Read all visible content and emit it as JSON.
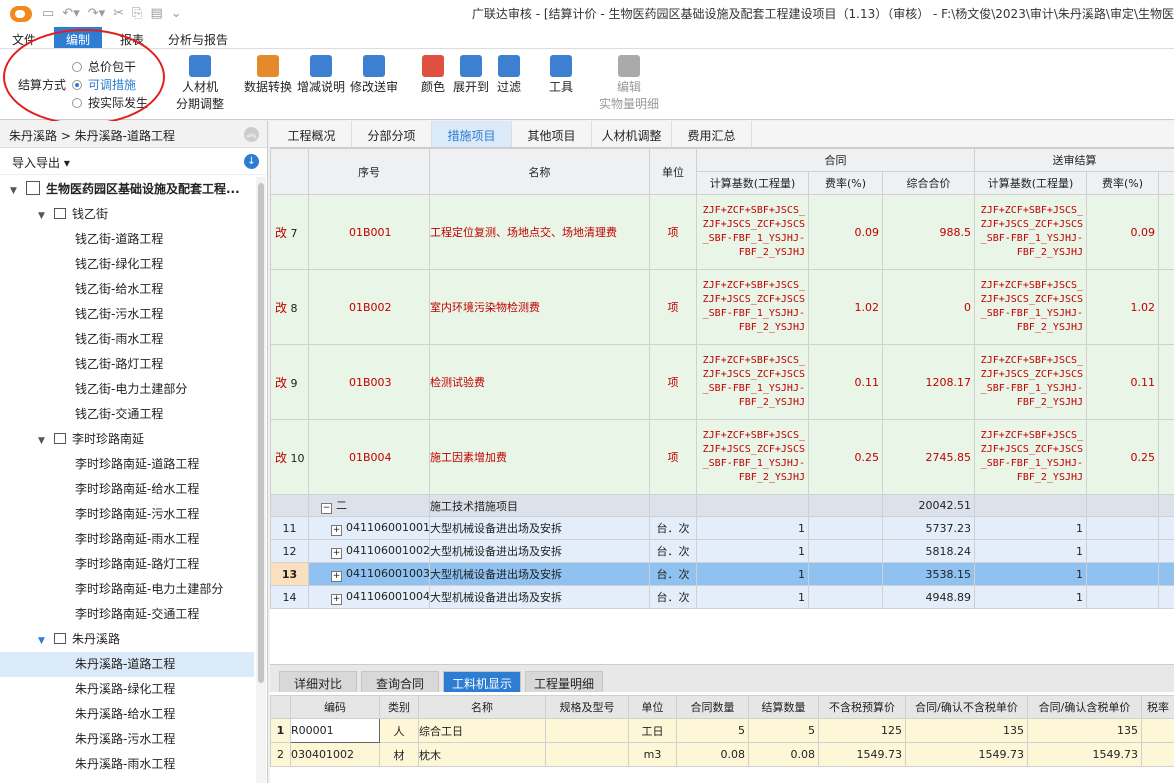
{
  "titlebar": {
    "title": "广联达审核 - [结算计价 - 生物医药园区基础设施及配套工程建设项目（1.13）（审核） - F:\\杨文俊\\2023\\审计\\朱丹溪路\\审定\\生物医"
  },
  "menus": [
    "文件",
    "编制",
    "报表",
    "分析与报告"
  ],
  "ribbon": {
    "settle_label": "结算方式",
    "opt1": "总价包干",
    "opt2": "可调措施",
    "opt3": "按实际发生",
    "tools": [
      {
        "l1": "人材机",
        "l2": "分期调整"
      },
      {
        "l1": "数据转换",
        "l2": ""
      },
      {
        "l1": "增减说明",
        "l2": ""
      },
      {
        "l1": "修改送审",
        "l2": ""
      },
      {
        "l1": "颜色",
        "l2": ""
      },
      {
        "l1": "展开到",
        "l2": ""
      },
      {
        "l1": "过滤",
        "l2": ""
      },
      {
        "l1": "工具",
        "l2": ""
      },
      {
        "l1": "编辑",
        "l2": "实物量明细"
      }
    ]
  },
  "left": {
    "breadcrumb": "朱丹溪路 > 朱丹溪路-道路工程",
    "import": "导入导出 ▾",
    "root": "生物医药园区基础设施及配套工程...",
    "g1": "钱乙街",
    "g1items": [
      "钱乙街-道路工程",
      "钱乙街-绿化工程",
      "钱乙街-给水工程",
      "钱乙街-污水工程",
      "钱乙街-雨水工程",
      "钱乙街-路灯工程",
      "钱乙街-电力土建部分",
      "钱乙街-交通工程"
    ],
    "g2": "李时珍路南延",
    "g2items": [
      "李时珍路南延-道路工程",
      "李时珍路南延-给水工程",
      "李时珍路南延-污水工程",
      "李时珍路南延-雨水工程",
      "李时珍路南延-路灯工程",
      "李时珍路南延-电力土建部分",
      "李时珍路南延-交通工程"
    ],
    "g3": "朱丹溪路",
    "g3items": [
      "朱丹溪路-道路工程",
      "朱丹溪路-绿化工程",
      "朱丹溪路-给水工程",
      "朱丹溪路-污水工程",
      "朱丹溪路-雨水工程"
    ]
  },
  "tabs": [
    "工程概况",
    "分部分项",
    "措施项目",
    "其他项目",
    "人材机调整",
    "费用汇总"
  ],
  "grid": {
    "h_seq": "序号",
    "h_name": "名称",
    "h_unit": "单位",
    "h_contract": "合同",
    "h_review": "送审结算",
    "h_base": "计算基数(工程量)",
    "h_rate": "费率(%)",
    "h_total": "综合合价",
    "base_text": "ZJF+ZCF+SBF+JSCS_ZJF+JSCS_ZCF+JSCS_SBF-FBF_1_YSJHJ-FBF_2_YSJHJ",
    "gai": "改",
    "rowsA": [
      {
        "n": "7",
        "code": "01B001",
        "name": "工程定位复测、场地点交、场地清理费",
        "unit": "项",
        "rate": "0.09",
        "total": "988.5",
        "rrate": "0.09"
      },
      {
        "n": "8",
        "code": "01B002",
        "name": "室内环境污染物检测费",
        "unit": "项",
        "rate": "1.02",
        "total": "0",
        "rrate": "1.02"
      },
      {
        "n": "9",
        "code": "01B003",
        "name": "检测试验费",
        "unit": "项",
        "rate": "0.11",
        "total": "1208.17",
        "rrate": "0.11"
      },
      {
        "n": "10",
        "code": "01B004",
        "name": "施工因素增加费",
        "unit": "项",
        "rate": "0.25",
        "total": "2745.85",
        "rrate": "0.25"
      }
    ],
    "group": {
      "code": "二",
      "name": "施工技术措施项目",
      "total": "20042.51"
    },
    "rowsC": [
      {
        "n": "11",
        "code": "041106001001",
        "name": "大型机械设备进出场及安拆",
        "unit": "台．次",
        "q": "1",
        "total": "5737.23",
        "rq": "1"
      },
      {
        "n": "12",
        "code": "041106001002",
        "name": "大型机械设备进出场及安拆",
        "unit": "台．次",
        "q": "1",
        "total": "5818.24",
        "rq": "1"
      },
      {
        "n": "13",
        "code": "041106001003",
        "name": "大型机械设备进出场及安拆",
        "unit": "台．次",
        "q": "1",
        "total": "3538.15",
        "rq": "1"
      },
      {
        "n": "14",
        "code": "041106001004",
        "name": "大型机械设备进出场及安拆",
        "unit": "台．次",
        "q": "1",
        "total": "4948.89",
        "rq": "1"
      }
    ]
  },
  "btabs": [
    "详细对比",
    "查询合同",
    "工料机显示",
    "工程量明细"
  ],
  "bgrid": {
    "headers": [
      "编码",
      "类别",
      "名称",
      "规格及型号",
      "单位",
      "合同数量",
      "结算数量",
      "不含税预算价",
      "合同/确认不含税单价",
      "合同/确认含税单价",
      "税率"
    ],
    "rows": [
      {
        "n": "1",
        "code": "R00001",
        "cat": "人",
        "name": "综合工日",
        "spec": "",
        "unit": "工日",
        "cq": "5",
        "sq": "5",
        "p1": "125",
        "p2": "135",
        "p3": "135"
      },
      {
        "n": "2",
        "code": "030401002",
        "cat": "材",
        "name": "枕木",
        "spec": "",
        "unit": "m3",
        "cq": "0.08",
        "sq": "0.08",
        "p1": "1549.73",
        "p2": "1549.73",
        "p3": "1549.73"
      }
    ]
  }
}
